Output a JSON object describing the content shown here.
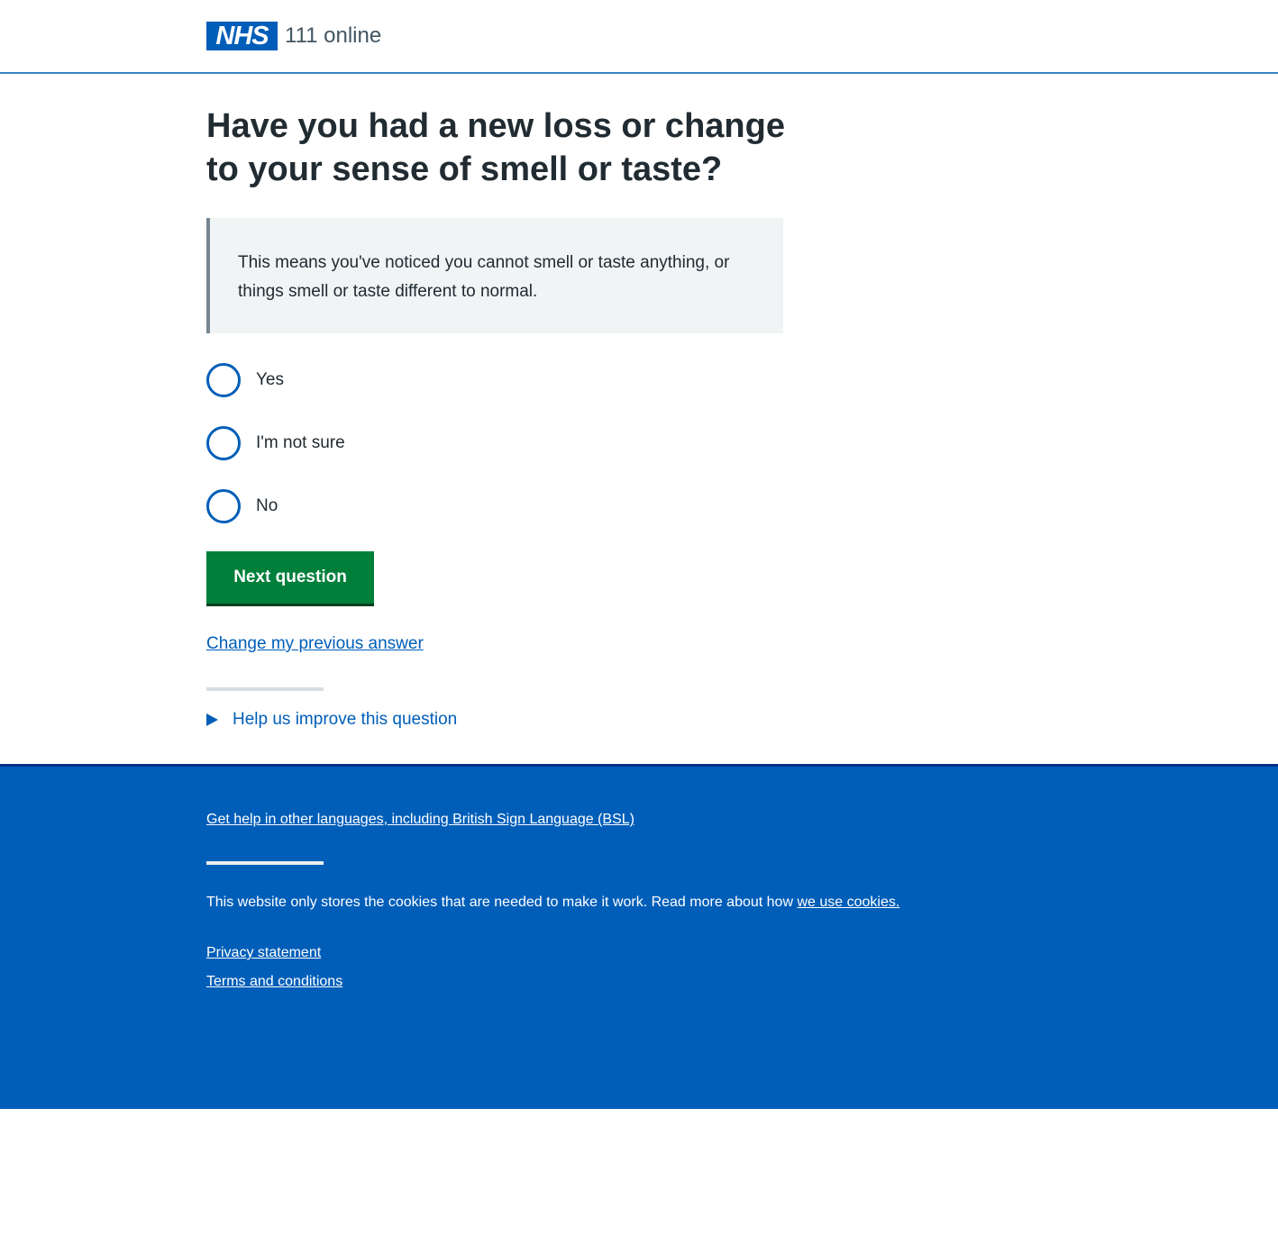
{
  "header": {
    "logo_text": "NHS",
    "service_name": "111 online"
  },
  "question": {
    "title": "Have you had a new loss or change to your sense of smell or taste?",
    "hint": "This means you've noticed you cannot smell or taste anything, or things smell or taste different to normal."
  },
  "options": [
    {
      "label": "Yes",
      "selected": false
    },
    {
      "label": "I'm not sure",
      "selected": false
    },
    {
      "label": "No",
      "selected": false
    }
  ],
  "actions": {
    "next_label": "Next question",
    "change_answer_label": "Change my previous answer",
    "feedback_label": "Help us improve this question"
  },
  "footer": {
    "languages_link": "Get help in other languages, including British Sign Language (BSL)",
    "cookies_text": "This website only stores the cookies that are needed to make it work. Read more about how ",
    "cookies_link": "we use cookies.",
    "privacy_link": "Privacy statement",
    "terms_link": "Terms and conditions"
  },
  "colors": {
    "nhs_blue": "#005eb8",
    "button_green": "#007f3b",
    "text": "#212b32",
    "inset_bg": "#f0f4f5"
  }
}
